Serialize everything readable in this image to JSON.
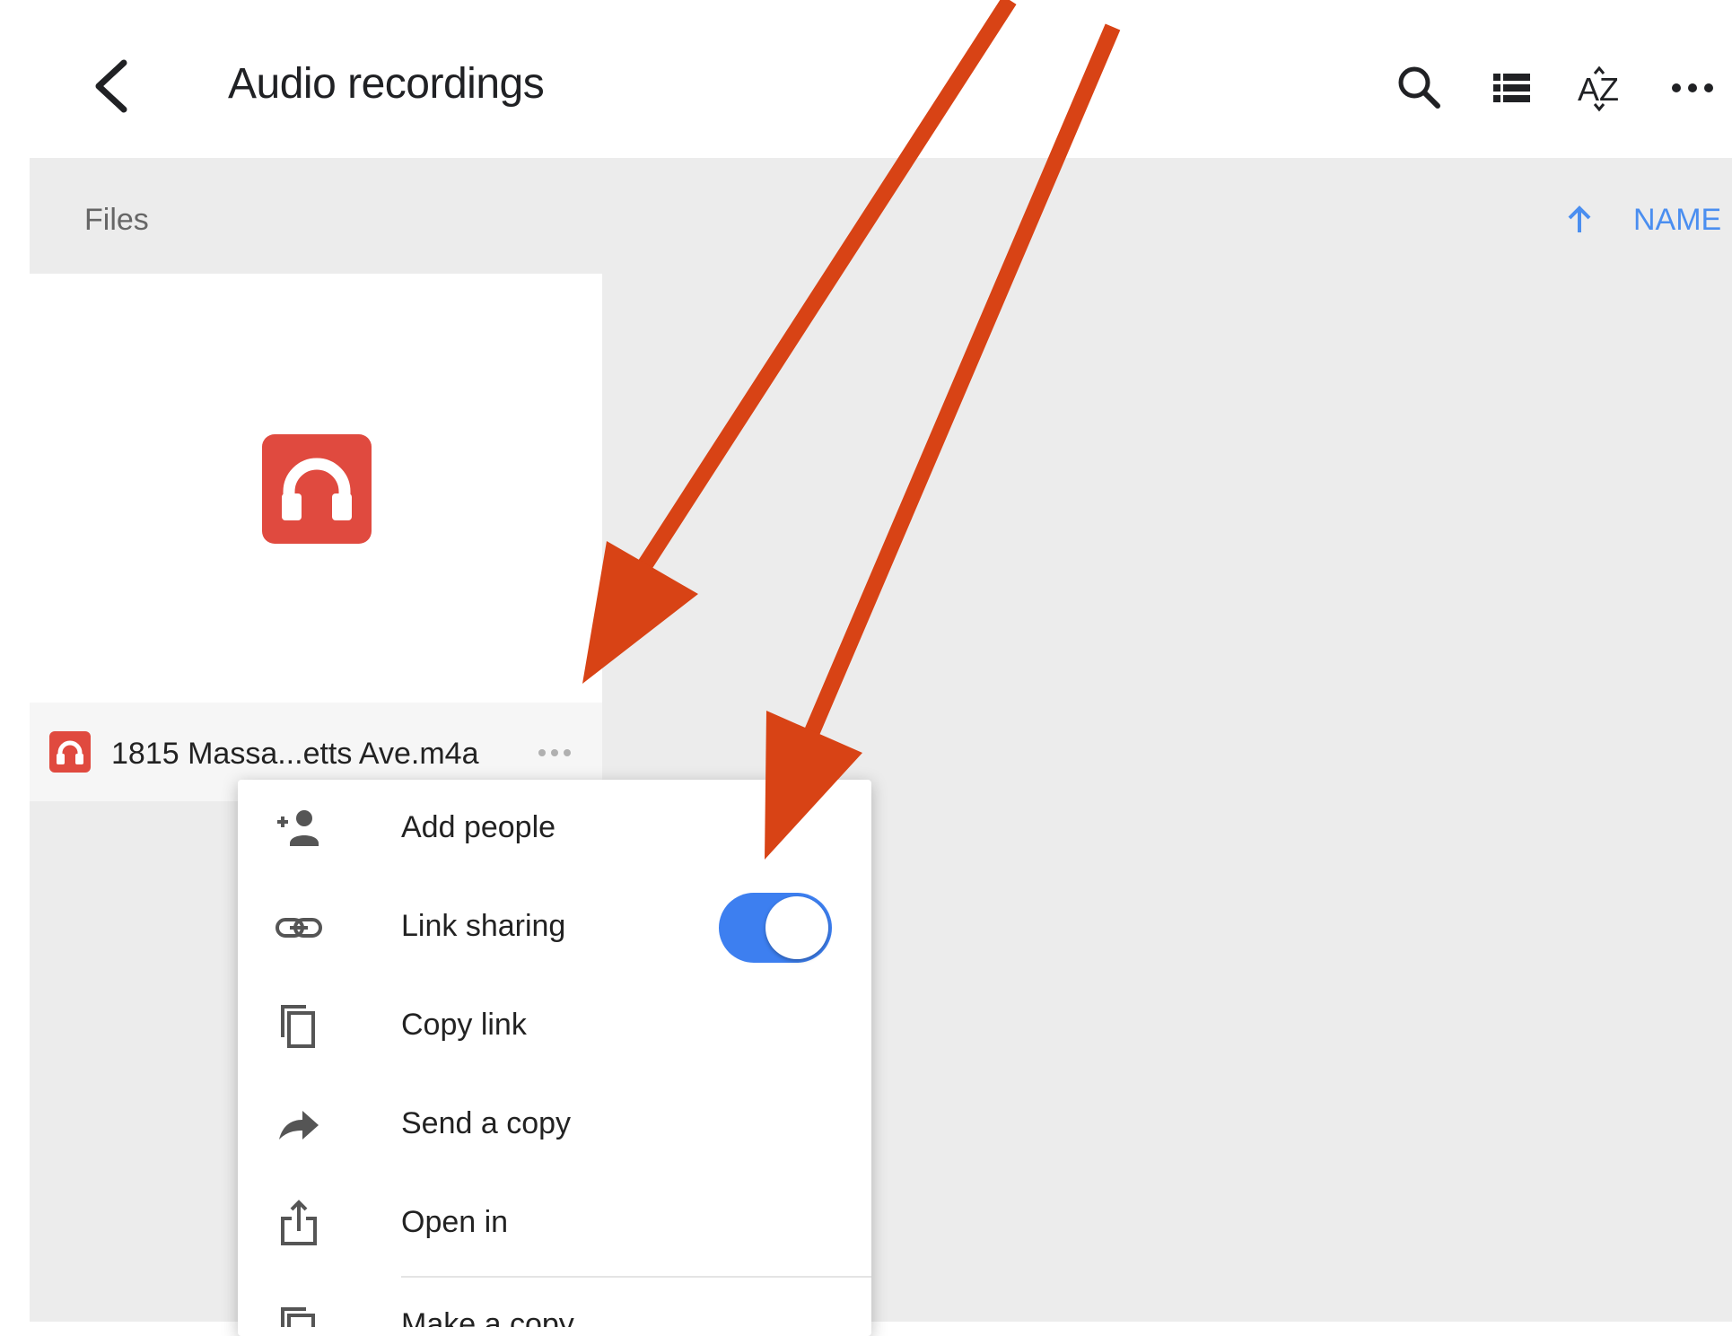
{
  "header": {
    "title": "Audio recordings",
    "icons": [
      "chevron-left-icon",
      "search-icon",
      "list-view-icon",
      "sort-az-icon",
      "more-horizontal-icon"
    ]
  },
  "section": {
    "files_label": "Files",
    "sort_label": "NAME",
    "sort_direction": "ascending"
  },
  "file": {
    "name": "1815 Massa...etts Ave.m4a",
    "icon": "audio-headphones-icon"
  },
  "menu": {
    "items": [
      {
        "label": "Add people",
        "icon": "person-add-icon"
      },
      {
        "label": "Link sharing",
        "icon": "link-icon"
      },
      {
        "label": "Copy link",
        "icon": "copy-icon"
      },
      {
        "label": "Send a copy",
        "icon": "share-arrow-icon"
      },
      {
        "label": "Open in",
        "icon": "export-icon"
      },
      {
        "label": "Make a copy",
        "icon": "make-copy-icon"
      }
    ],
    "link_sharing_on": true
  },
  "colors": {
    "accent": "#4a8ef0",
    "toggle_on": "#3d7ff0",
    "audio_file": "#e04a3f",
    "annotation_arrow": "#d84315",
    "content_bg": "#ececec"
  }
}
